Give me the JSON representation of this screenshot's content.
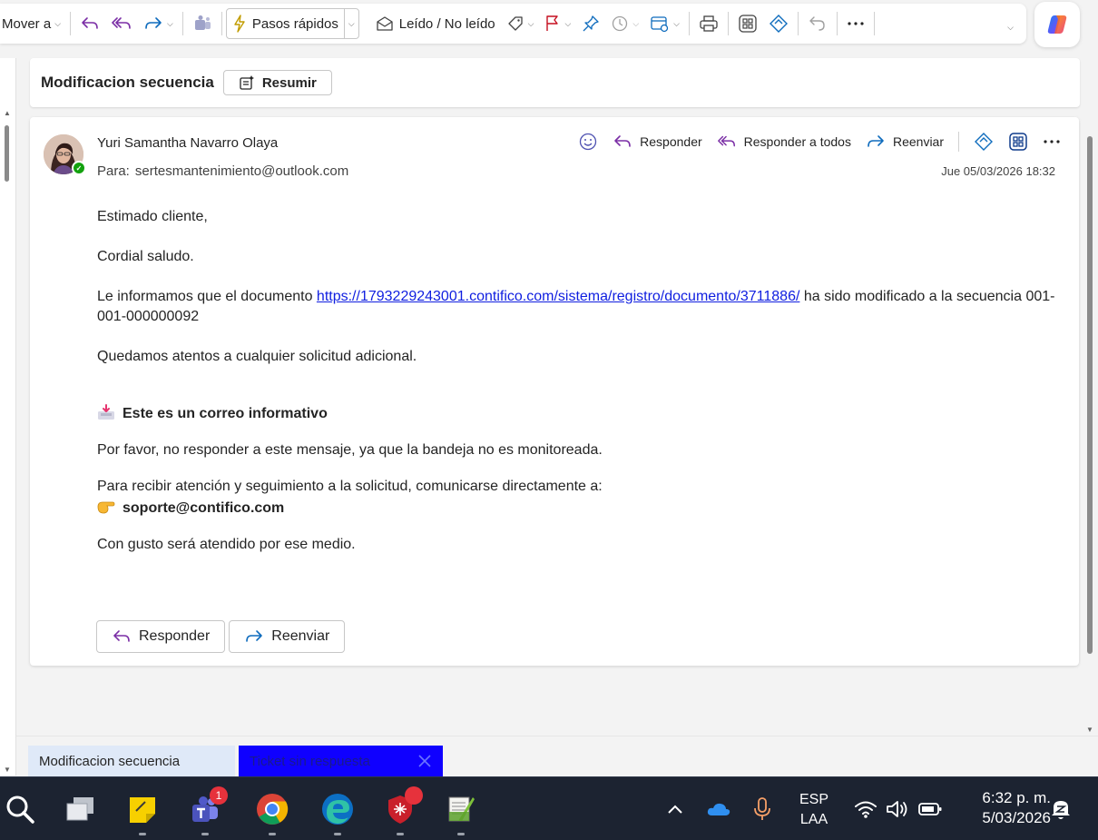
{
  "toolbar": {
    "move_label": "Mover a",
    "quick_steps_label": "Pasos rápidos",
    "read_unread_label": "Leído / No leído"
  },
  "subject": {
    "title": "Modificacion secuencia",
    "summarize_label": "Resumir"
  },
  "message": {
    "sender": "Yuri Samantha Navarro Olaya",
    "to_label": "Para:",
    "to_address": "sertesmantenimiento@outlook.com",
    "date": "Jue 05/03/2026 18:32",
    "actions": {
      "reply": "Responder",
      "reply_all": "Responder a todos",
      "forward": "Reenviar"
    },
    "body": {
      "greeting": "Estimado cliente,",
      "salutation": "Cordial saludo.",
      "line1_prefix": "Le informamos que el documento ",
      "line1_link": "https://1793229243001.contifico.com/sistema/registro/documento/3711886/",
      "line1_suffix": " ha sido modificado a la secuencia 001-001-000000092",
      "closing": "Quedamos atentos a cualquier solicitud adicional.",
      "info_title": "Este es un correo informativo",
      "no_reply": "Por favor, no responder a este mensaje, ya que la bandeja no es monitoreada.",
      "contact_intro": "Para recibir atención y seguimiento a la solicitud, comunicarse directamente a:",
      "contact_email": "soporte@contifico.com",
      "final": "Con gusto será atendido por ese medio."
    },
    "footer_buttons": {
      "reply": "Responder",
      "forward": "Reenviar"
    }
  },
  "tabs": [
    {
      "label": "Modificacion secuencia"
    },
    {
      "label": "Ticket sin respuesta"
    }
  ],
  "taskbar": {
    "teams_badge": "1",
    "language": "ESP",
    "layout": "LAA",
    "time": "6:32 p. m.",
    "date": "5/03/2026"
  },
  "colors": {
    "accent": "#0f6cbd",
    "link": "#0f1ee0",
    "reply_icon": "#7b2fa6",
    "tab_active_bg": "#0f00ff"
  }
}
